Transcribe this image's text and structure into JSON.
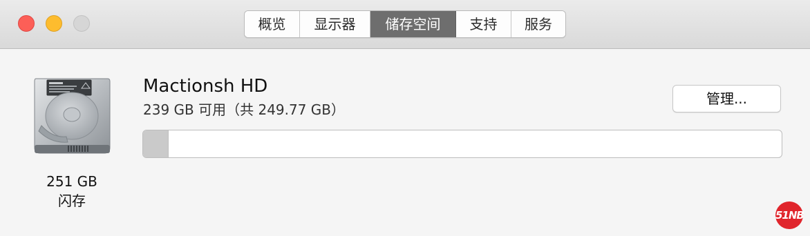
{
  "window": {
    "traffic_lights": [
      "close",
      "minimize",
      "zoom"
    ],
    "colors": {
      "close": "#fc5f57",
      "minimize": "#fdbc2e",
      "zoom": "#d6d6d6",
      "active_tab": "#6e6e6e"
    }
  },
  "tabs": [
    {
      "label": "概览",
      "active": false
    },
    {
      "label": "显示器",
      "active": false
    },
    {
      "label": "储存空间",
      "active": true
    },
    {
      "label": "支持",
      "active": false
    },
    {
      "label": "服务",
      "active": false
    }
  ],
  "drive": {
    "icon": "hard-drive-icon",
    "capacity": "251 GB",
    "type": "闪存",
    "name": "Mactionsh HD",
    "available": "239 GB 可用（共 249.77 GB）",
    "used_fraction": 0.04
  },
  "actions": {
    "manage_label": "管理..."
  },
  "watermark": {
    "text": "51NB",
    "color": "#e0252c"
  }
}
